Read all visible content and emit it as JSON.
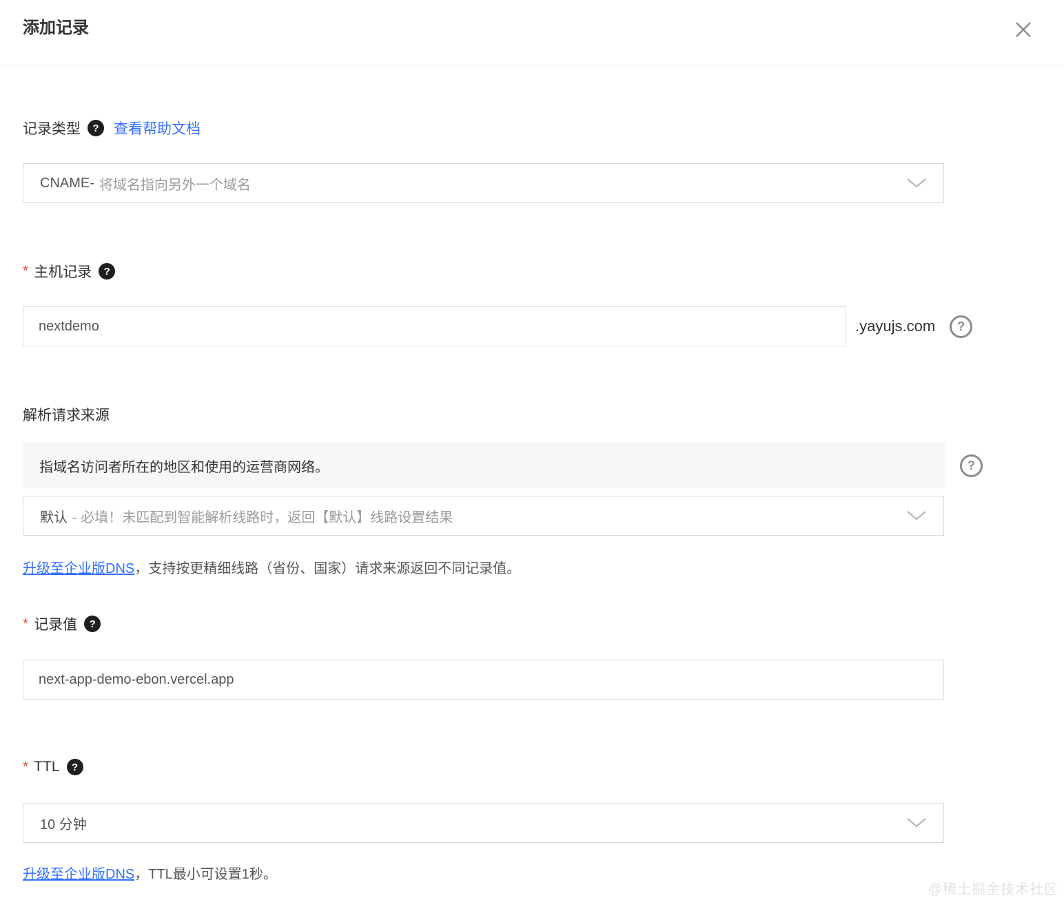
{
  "dialog": {
    "title": "添加记录"
  },
  "icons": {
    "help_filled_glyph": "?",
    "help_outline_glyph": "?"
  },
  "colors": {
    "link_blue": "#3370ff",
    "required_red": "#e34d3c",
    "text_dark": "#333333",
    "text_gray": "#999999",
    "border_gray": "#d9d9d9",
    "info_bg": "#f7f7f7"
  },
  "form": {
    "record_type": {
      "label": "记录类型",
      "help_doc_link": "查看帮助文档",
      "select_value_primary": "CNAME-",
      "select_value_secondary": "将域名指向另外一个域名"
    },
    "host_record": {
      "required_mark": "*",
      "label": "主机记录",
      "input_value": "nextdemo",
      "domain_suffix": ".yayujs.com"
    },
    "resolution_source": {
      "label": "解析请求来源",
      "info_text": "指域名访问者所在的地区和使用的运营商网络。",
      "select_value_primary": "默认",
      "select_value_secondary": "- 必填！未匹配到智能解析线路时，返回【默认】线路设置结果",
      "upgrade_link": "升级至企业版DNS",
      "upgrade_rest": "，支持按更精细线路（省份、国家）请求来源返回不同记录值。"
    },
    "record_value": {
      "required_mark": "*",
      "label": "记录值",
      "input_value": "next-app-demo-ebon.vercel.app"
    },
    "ttl": {
      "required_mark": "*",
      "label": "TTL",
      "select_value_primary": "10 分钟",
      "upgrade_link": "升级至企业版DNS",
      "upgrade_rest": "，TTL最小可设置1秒。"
    }
  },
  "watermark": "@稀土掘金技术社区"
}
